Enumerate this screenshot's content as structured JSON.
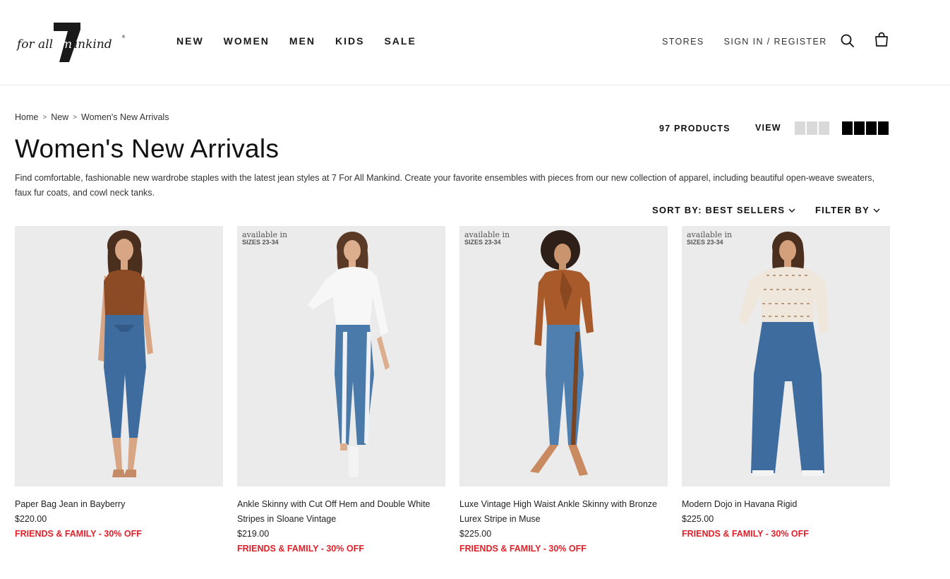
{
  "brand": {
    "logo_text": "for all mankind",
    "logo_mark": "7"
  },
  "main_nav": [
    "NEW",
    "WOMEN",
    "MEN",
    "KIDS",
    "SALE"
  ],
  "util_nav": {
    "stores": "STORES",
    "sign_in": "SIGN IN / REGISTER"
  },
  "icons": {
    "search": "search-icon",
    "bag": "shopping-bag-icon"
  },
  "breadcrumb": {
    "home": "Home",
    "new": "New",
    "current": "Women's New Arrivals",
    "separator": ">"
  },
  "page": {
    "title": "Women's New Arrivals",
    "description": "Find comfortable, fashionable new wardrobe staples with the latest jean styles at 7 For All Mankind. Create your favorite ensembles with pieces from our new collection of apparel, including beautiful open-weave sweaters, faux fur coats, and cowl neck tanks."
  },
  "toolbar": {
    "product_count": "97 PRODUCTS",
    "view_label": "VIEW",
    "view_options": [
      "3-column",
      "4-column"
    ],
    "selected_view": "4-column",
    "sort_label": "SORT BY: BEST SELLERS",
    "filter_label": "FILTER BY"
  },
  "badge": {
    "line1": "available in",
    "line2": "SIZES 23-34"
  },
  "products": [
    {
      "name": "Paper Bag Jean in Bayberry",
      "price": "$220.00",
      "promo": "FRIENDS & FAMILY - 30% OFF",
      "has_size_badge": false
    },
    {
      "name": "Ankle Skinny with Cut Off Hem and Double White Stripes in Sloane Vintage",
      "price": "$219.00",
      "promo": "FRIENDS & FAMILY - 30% OFF",
      "has_size_badge": true
    },
    {
      "name": "Luxe Vintage High Waist Ankle Skinny with Bronze Lurex Stripe in Muse",
      "price": "$225.00",
      "promo": "FRIENDS & FAMILY - 30% OFF",
      "has_size_badge": true
    },
    {
      "name": "Modern Dojo in Havana Rigid",
      "price": "$225.00",
      "promo": "FRIENDS & FAMILY - 30% OFF",
      "has_size_badge": true
    }
  ],
  "colors": {
    "promo": "#e0212a",
    "text": "#1a1a1a",
    "image_bg": "#ebebec",
    "denim": "#3f6c9e",
    "view_active": "#000000",
    "view_inactive": "#d9d9d9"
  }
}
